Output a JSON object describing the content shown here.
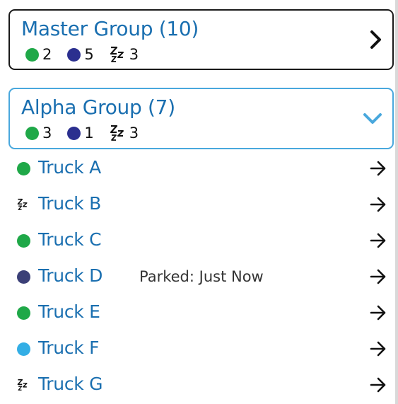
{
  "groups": [
    {
      "title": "Master Group (10)",
      "expanded": false,
      "counts": {
        "active": "2",
        "parked": "5",
        "sleeping": "3"
      }
    },
    {
      "title": "Alpha Group (7)",
      "expanded": true,
      "counts": {
        "active": "3",
        "parked": "1",
        "sleeping": "3"
      }
    }
  ],
  "trucks": [
    {
      "name": "Truck A",
      "status": "active",
      "note": ""
    },
    {
      "name": "Truck B",
      "status": "sleeping",
      "note": ""
    },
    {
      "name": "Truck C",
      "status": "active",
      "note": ""
    },
    {
      "name": "Truck D",
      "status": "parked",
      "note": "Parked: Just Now"
    },
    {
      "name": "Truck E",
      "status": "active",
      "note": ""
    },
    {
      "name": "Truck F",
      "status": "idle",
      "note": ""
    },
    {
      "name": "Truck G",
      "status": "sleeping",
      "note": ""
    }
  ],
  "colors": {
    "active": "#1fa848",
    "parked_count": "#2b2f8f",
    "parked": "#3b4077",
    "idle": "#33aee5",
    "link_text": "#1a6fb0",
    "selected_border": "#49a8dd"
  },
  "icons": {
    "sleeping": "zz-sleep-icon",
    "collapsed": "chevron-right-icon",
    "expanded": "chevron-down-icon",
    "row_action": "arrow-right-icon"
  }
}
